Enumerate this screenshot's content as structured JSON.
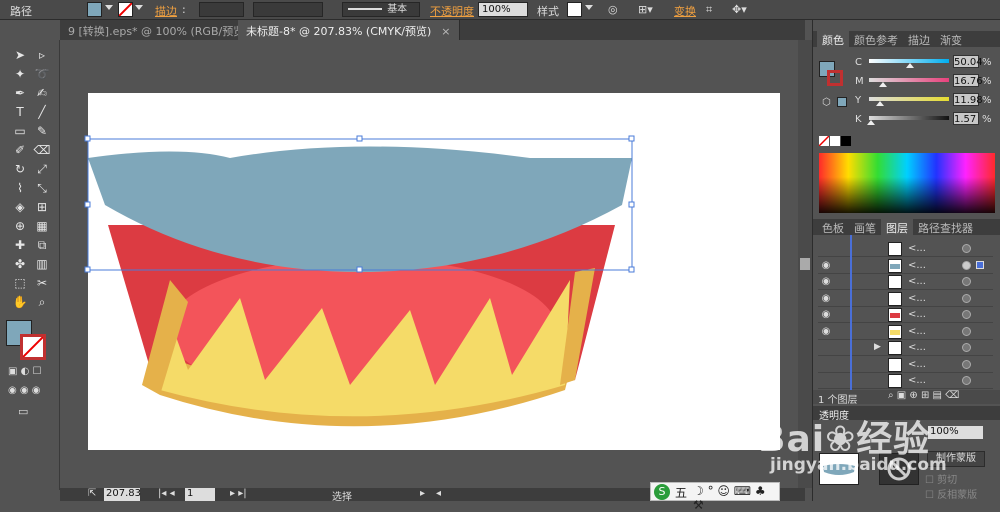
{
  "control_bar": {
    "path_label": "路径",
    "fill_color": "#7fa7ba",
    "stroke_label": "描边",
    "stroke_style_label": "基本",
    "opacity_label": "不透明度",
    "opacity_value": "100%",
    "style_label": "样式",
    "transform_label": "变换"
  },
  "tabs": [
    {
      "label": "9 [转换].eps* @ 100% (RGB/预览)",
      "close": "×",
      "active": false
    },
    {
      "label": "未标题-8* @ 207.83% (CMYK/预览)",
      "close": "×",
      "active": true
    }
  ],
  "toolbar": {
    "fill_color": "#7fa7ba",
    "tools": [
      "select",
      "direct-select",
      "magic-wand",
      "lasso",
      "pen",
      "curvature",
      "type",
      "line",
      "rectangle",
      "paintbrush",
      "pencil",
      "eraser",
      "rotate",
      "scale",
      "warp",
      "free-transform",
      "shape-builder",
      "perspective",
      "mesh",
      "gradient",
      "eyedropper",
      "blend",
      "symbol-sprayer",
      "graph",
      "artboard",
      "slice",
      "hand",
      "zoom"
    ]
  },
  "status_bar": {
    "zoom_value": "207.83",
    "page_value": "1",
    "mode_label": "选择"
  },
  "color_panel": {
    "tabs": [
      "颜色",
      "颜色参考",
      "描边",
      "渐变"
    ],
    "sliders": [
      {
        "label": "C",
        "value": "50.04",
        "unit": "%"
      },
      {
        "label": "M",
        "value": "16.76",
        "unit": "%"
      },
      {
        "label": "Y",
        "value": "11.98",
        "unit": "%"
      },
      {
        "label": "K",
        "value": "1.57",
        "unit": "%"
      }
    ],
    "fill_color": "#7fa7ba"
  },
  "layers_panel": {
    "tabs": [
      "色板",
      "画笔",
      "图层",
      "路径查找器"
    ],
    "rows": [
      {
        "name": "<...",
        "visible": false,
        "thumb": "white",
        "selected": false
      },
      {
        "name": "<...",
        "visible": true,
        "thumb": "blue",
        "selected": true
      },
      {
        "name": "<...",
        "visible": true,
        "thumb": "white",
        "selected": false
      },
      {
        "name": "<...",
        "visible": true,
        "thumb": "white",
        "selected": false
      },
      {
        "name": "<...",
        "visible": true,
        "thumb": "red",
        "selected": false
      },
      {
        "name": "<...",
        "visible": true,
        "thumb": "yellow",
        "selected": false
      },
      {
        "name": "<...",
        "visible": false,
        "thumb": "white",
        "selected": false
      },
      {
        "name": "<...",
        "visible": false,
        "thumb": "white",
        "selected": false
      },
      {
        "name": "<...",
        "visible": false,
        "thumb": "white",
        "selected": false
      }
    ],
    "footer_label": "1 个图层"
  },
  "transparency_panel": {
    "title": "透明度",
    "opacity_value": "100%",
    "make_mask_label": "制作蒙版",
    "clip_label": "剪切",
    "invert_mask_label": "反相蒙版"
  },
  "watermark": {
    "brand": "Bai",
    "brand2": "经验",
    "url": "jingyan.baidu.com"
  },
  "ime_bar": {
    "label": "五"
  }
}
